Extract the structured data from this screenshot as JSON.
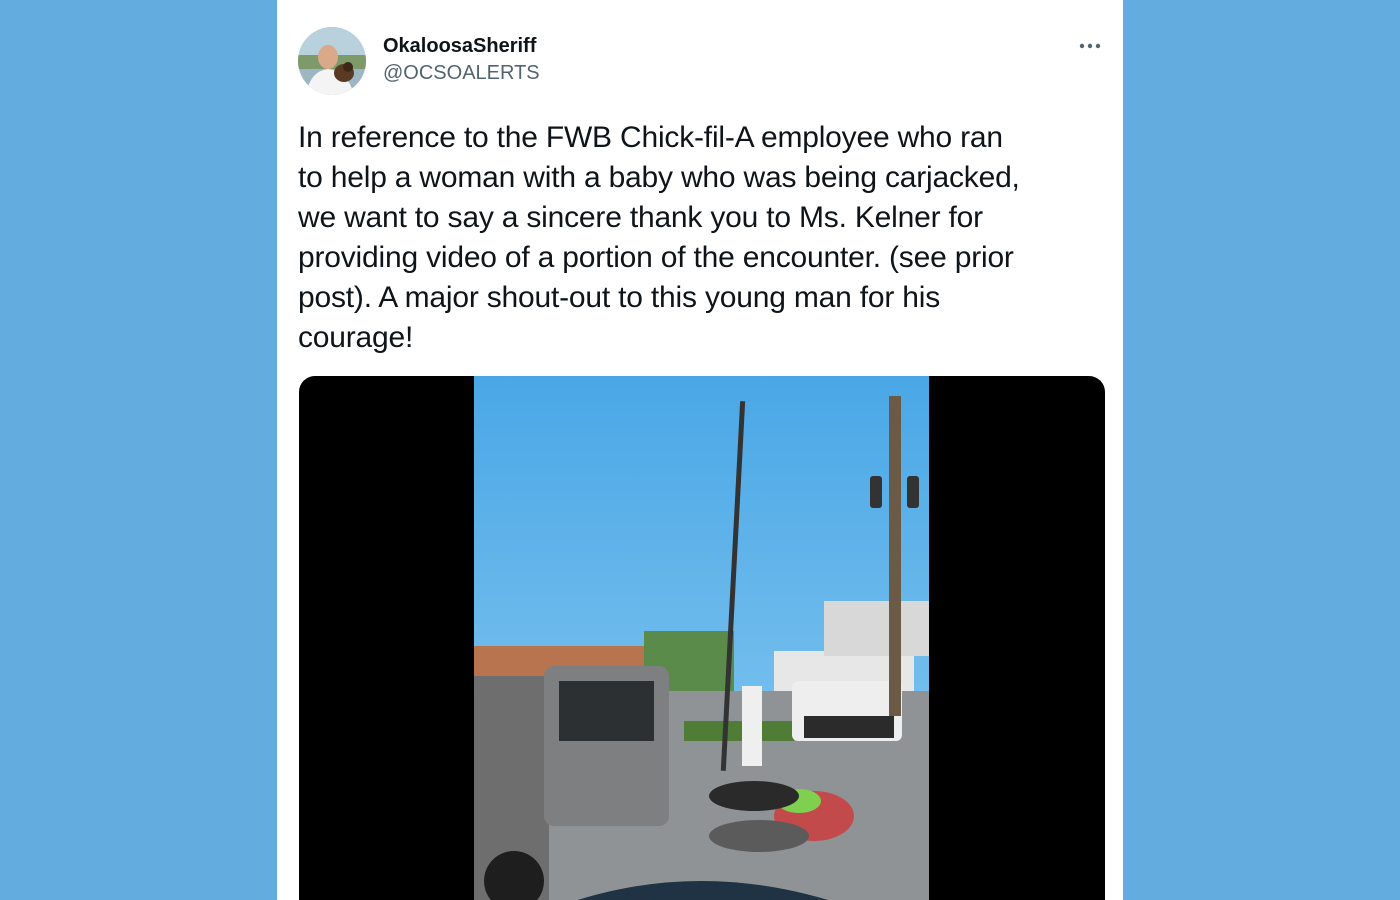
{
  "tweet": {
    "display_name": "OkaloosaSheriff",
    "handle": "@OCSOALERTS",
    "more_icon": "more-horizontal-icon",
    "text_lines": [
      "In reference to the FWB Chick-fil-A employee who ran",
      "to help a woman with a baby who was being carjacked,",
      "we want to say a sincere thank you to Ms. Kelner for",
      "providing video of a portion of the encounter. (see prior",
      "post). A major shout-out to this young man for his",
      "courage!"
    ]
  },
  "colors": {
    "background": "#62acdf",
    "card": "#ffffff",
    "text": "#0f1419",
    "secondary_text": "#536471"
  }
}
